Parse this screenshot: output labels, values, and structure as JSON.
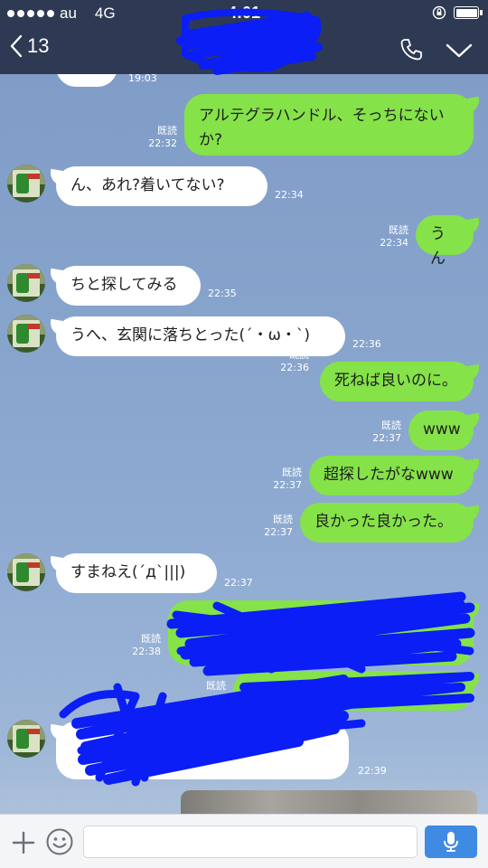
{
  "status_bar": {
    "carrier": "au",
    "network": "4G",
    "time": "4:01"
  },
  "nav": {
    "back_count": "13",
    "title": ""
  },
  "messages": [
    {
      "side": "in",
      "time": "19:03",
      "text": ""
    },
    {
      "side": "out",
      "read": "既読",
      "time": "22:32",
      "text": "アルテグラハンドル、そっちにないか?"
    },
    {
      "side": "in",
      "time": "22:34",
      "text": "ん、あれ?着いてない?"
    },
    {
      "side": "out",
      "read": "既読",
      "time": "22:34",
      "text": "うん"
    },
    {
      "side": "in",
      "time": "22:35",
      "text": "ちと探してみる"
    },
    {
      "side": "in",
      "time": "22:36",
      "text": "うへ、玄関に落ちとった(´・ω・`)"
    },
    {
      "side": "out",
      "read": "既読",
      "time": "22:36",
      "text": "死ねば良いのに。"
    },
    {
      "side": "out",
      "read": "既読",
      "time": "22:37",
      "text": "www"
    },
    {
      "side": "out",
      "read": "既読",
      "time": "22:37",
      "text": "超探したがなwww"
    },
    {
      "side": "out",
      "read": "既読",
      "time": "22:37",
      "text": "良かった良かった。"
    },
    {
      "side": "in",
      "time": "22:37",
      "text": "すまねえ(´д`|||)"
    },
    {
      "side": "out",
      "read": "既読",
      "time": "22:38",
      "text": ""
    },
    {
      "side": "out",
      "read": "既読",
      "time": "",
      "text": ""
    },
    {
      "side": "in",
      "time": "22:39",
      "text": ""
    }
  ],
  "input": {
    "placeholder": ""
  },
  "colors": {
    "header": "#2e3a53",
    "outgoing_bubble": "#85e249",
    "incoming_bubble": "#ffffff",
    "mic_button": "#3f8ae3",
    "scribble": "#0a1ef5"
  },
  "icons": {
    "back": "chevron-left-icon",
    "call": "phone-icon",
    "menu": "chevron-down-icon",
    "attach": "plus-icon",
    "emoji": "smile-icon",
    "voice": "mic-icon"
  }
}
